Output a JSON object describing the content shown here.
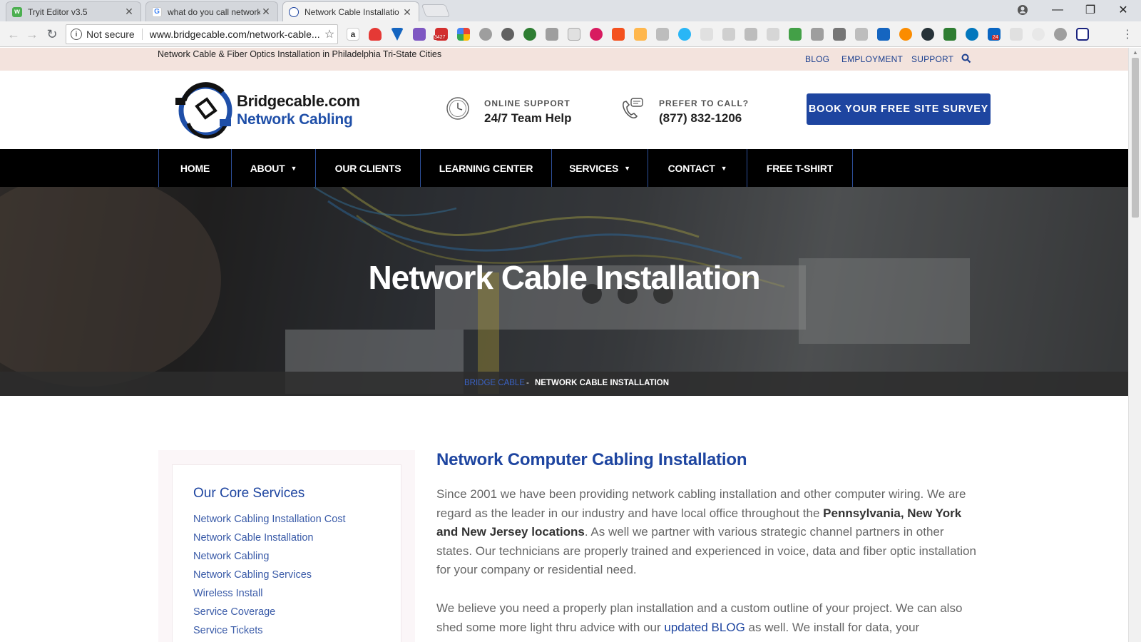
{
  "browser": {
    "tabs": [
      {
        "title": "Tryit Editor v3.5",
        "active": false
      },
      {
        "title": "what do you call network",
        "active": false
      },
      {
        "title": "Network Cable Installatio",
        "active": true
      }
    ],
    "security_label": "Not secure",
    "url": "www.bridgecable.com/network-cable...",
    "extension_badges": {
      "mail": "3427",
      "linkedin": "24"
    }
  },
  "topbar": {
    "tagline": "Network Cable & Fiber Optics Installation in Philadelphia Tri-State Cities",
    "links": [
      "BLOG",
      "EMPLOYMENT",
      "SUPPORT"
    ]
  },
  "header": {
    "logo_line1": "Bridgecable.com",
    "logo_line2": "Network Cabling",
    "support_label": "ONLINE SUPPORT",
    "support_value": "24/7 Team Help",
    "call_label": "PREFER TO CALL?",
    "call_value": "(877) 832-1206",
    "cta": "BOOK YOUR FREE SITE SURVEY"
  },
  "nav": {
    "items": [
      {
        "label": "HOME",
        "dropdown": false
      },
      {
        "label": "ABOUT",
        "dropdown": true
      },
      {
        "label": "OUR CLIENTS",
        "dropdown": false
      },
      {
        "label": "LEARNING CENTER",
        "dropdown": false
      },
      {
        "label": "SERVICES",
        "dropdown": true
      },
      {
        "label": "CONTACT",
        "dropdown": true
      },
      {
        "label": "FREE T-SHIRT",
        "dropdown": false
      }
    ]
  },
  "hero": {
    "title": "Network Cable Installation",
    "breadcrumb_home": "BRIDGE CABLE",
    "breadcrumb_sep": "-",
    "breadcrumb_current": "NETWORK CABLE INSTALLATION"
  },
  "sidebar": {
    "title": "Our Core Services",
    "links": [
      "Network Cabling Installation Cost",
      "Network Cable Installation",
      "Network Cabling",
      "Network Cabling Services",
      "Wireless Install",
      "Service Coverage",
      "Service Tickets"
    ]
  },
  "content": {
    "heading": "Network Computer Cabling Installation",
    "p1_a": "Since 2001 we have been providing network cabling installation and other computer wiring. We are regard as the leader in our industry and have local office throughout the ",
    "p1_bold": "Pennsylvania, New York and New Jersey locations",
    "p1_b": ". As well we partner with various strategic channel partners in other states. Our technicians are properly trained and experienced in voice, data and fiber optic installation for your company or residential need.",
    "p2_a": "We believe you need a properly plan installation and a custom outline of your project. We can also shed some more light thru advice with our ",
    "p2_link": "updated BLOG",
    "p2_b": " as well. We install for data, your"
  },
  "colors": {
    "brand_blue": "#1e45a0",
    "topbar_bg": "#f3e3dd",
    "nav_bg": "#000000"
  }
}
